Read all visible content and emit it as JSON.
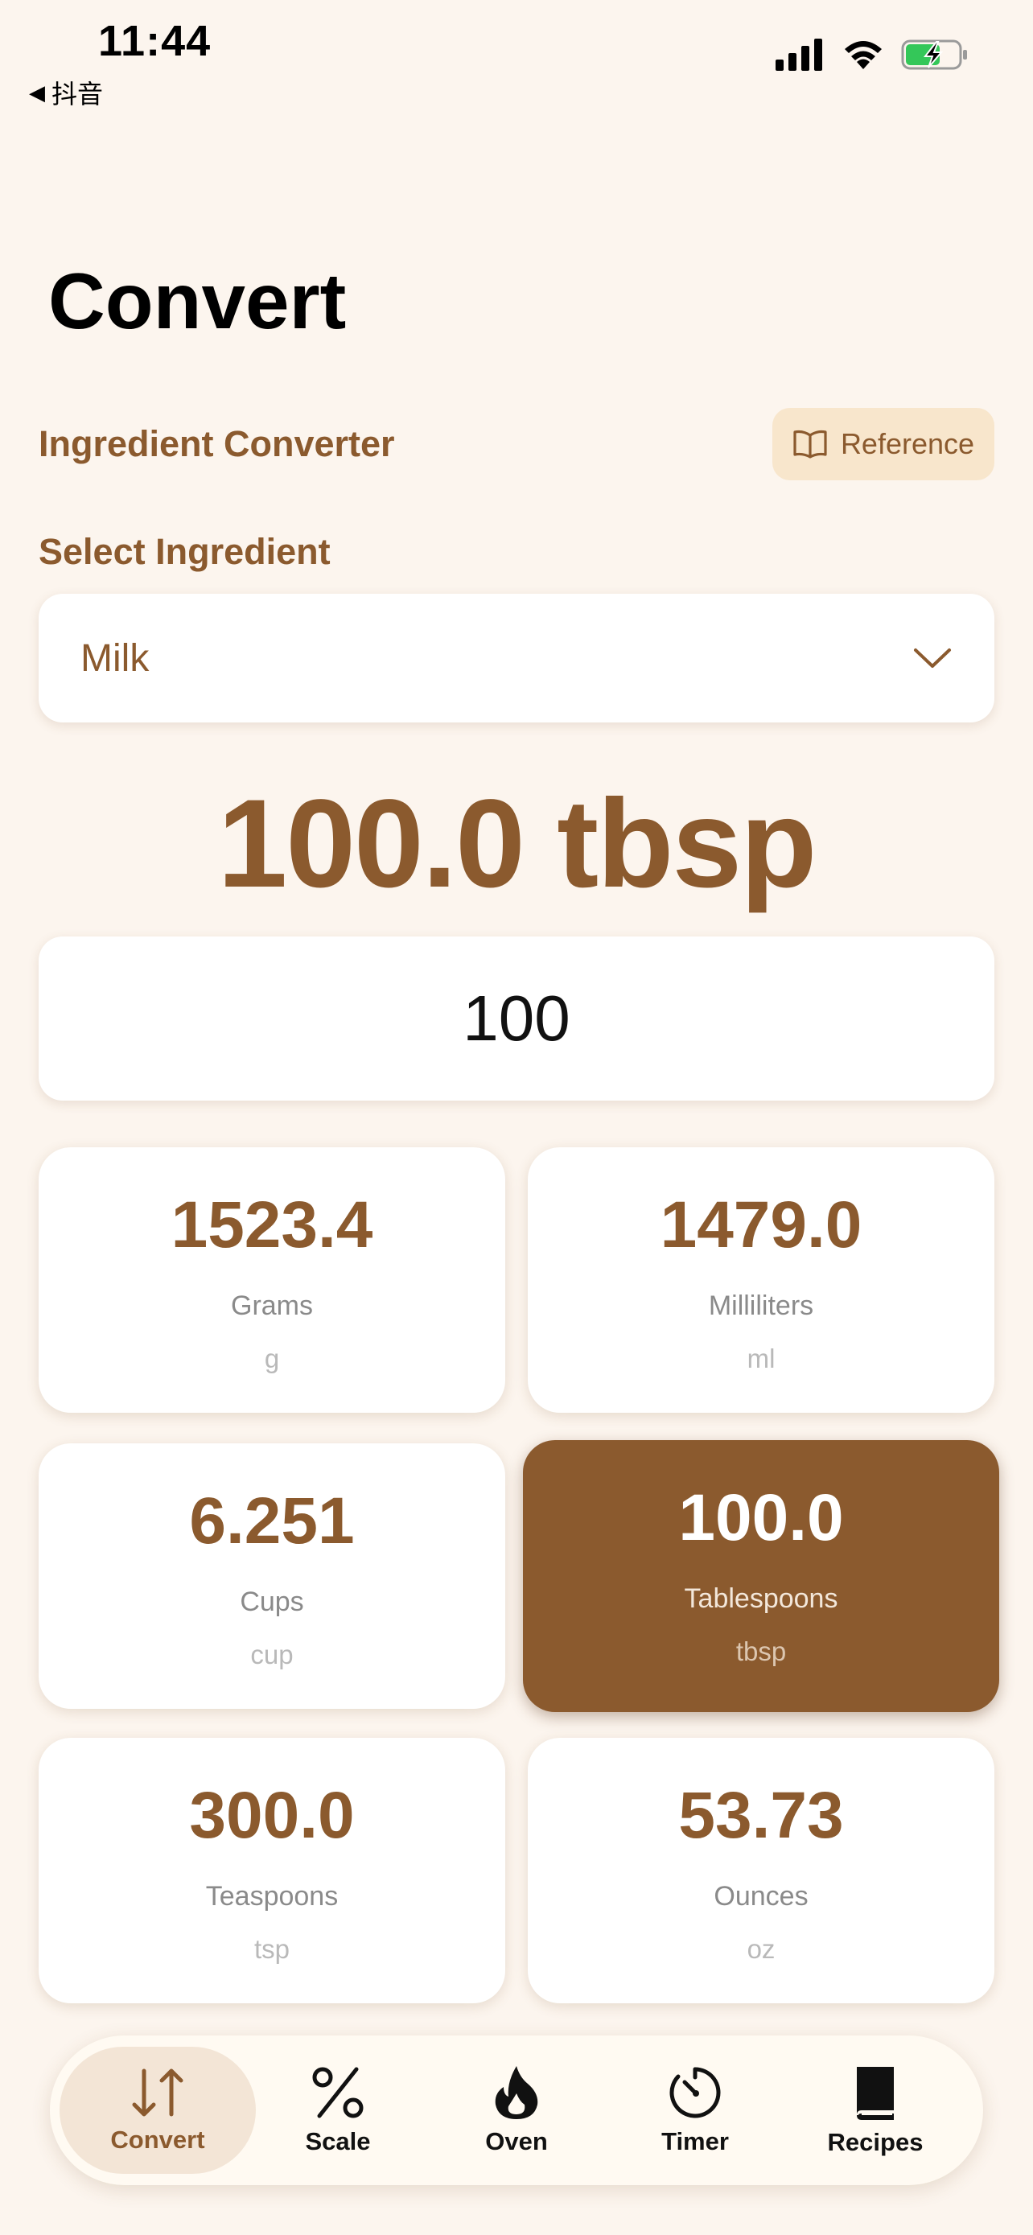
{
  "status_bar": {
    "time": "11:44",
    "back_label": "抖音"
  },
  "page": {
    "title": "Convert"
  },
  "converter": {
    "section_label": "Ingredient Converter",
    "reference_label": "Reference",
    "select_label": "Select Ingredient",
    "selected_ingredient": "Milk",
    "result_display": "100.0 tbsp",
    "amount_value": "100"
  },
  "units": [
    {
      "value": "1523.4",
      "name": "Grams",
      "abbr": "g",
      "active": false
    },
    {
      "value": "1479.0",
      "name": "Milliliters",
      "abbr": "ml",
      "active": false
    },
    {
      "value": "6.251",
      "name": "Cups",
      "abbr": "cup",
      "active": false
    },
    {
      "value": "100.0",
      "name": "Tablespoons",
      "abbr": "tbsp",
      "active": true
    },
    {
      "value": "300.0",
      "name": "Teaspoons",
      "abbr": "tsp",
      "active": false
    },
    {
      "value": "53.73",
      "name": "Ounces",
      "abbr": "oz",
      "active": false
    }
  ],
  "tabs": [
    {
      "label": "Convert",
      "icon": "convert-arrows-icon",
      "active": true
    },
    {
      "label": "Scale",
      "icon": "percent-icon",
      "active": false
    },
    {
      "label": "Oven",
      "icon": "flame-icon",
      "active": false
    },
    {
      "label": "Timer",
      "icon": "timer-icon",
      "active": false
    },
    {
      "label": "Recipes",
      "icon": "book-icon",
      "active": false
    }
  ],
  "colors": {
    "accent": "#8b5a2e",
    "background": "#fcf5ee",
    "reference_bg": "#f8e6cc",
    "battery_green": "#34c759"
  }
}
